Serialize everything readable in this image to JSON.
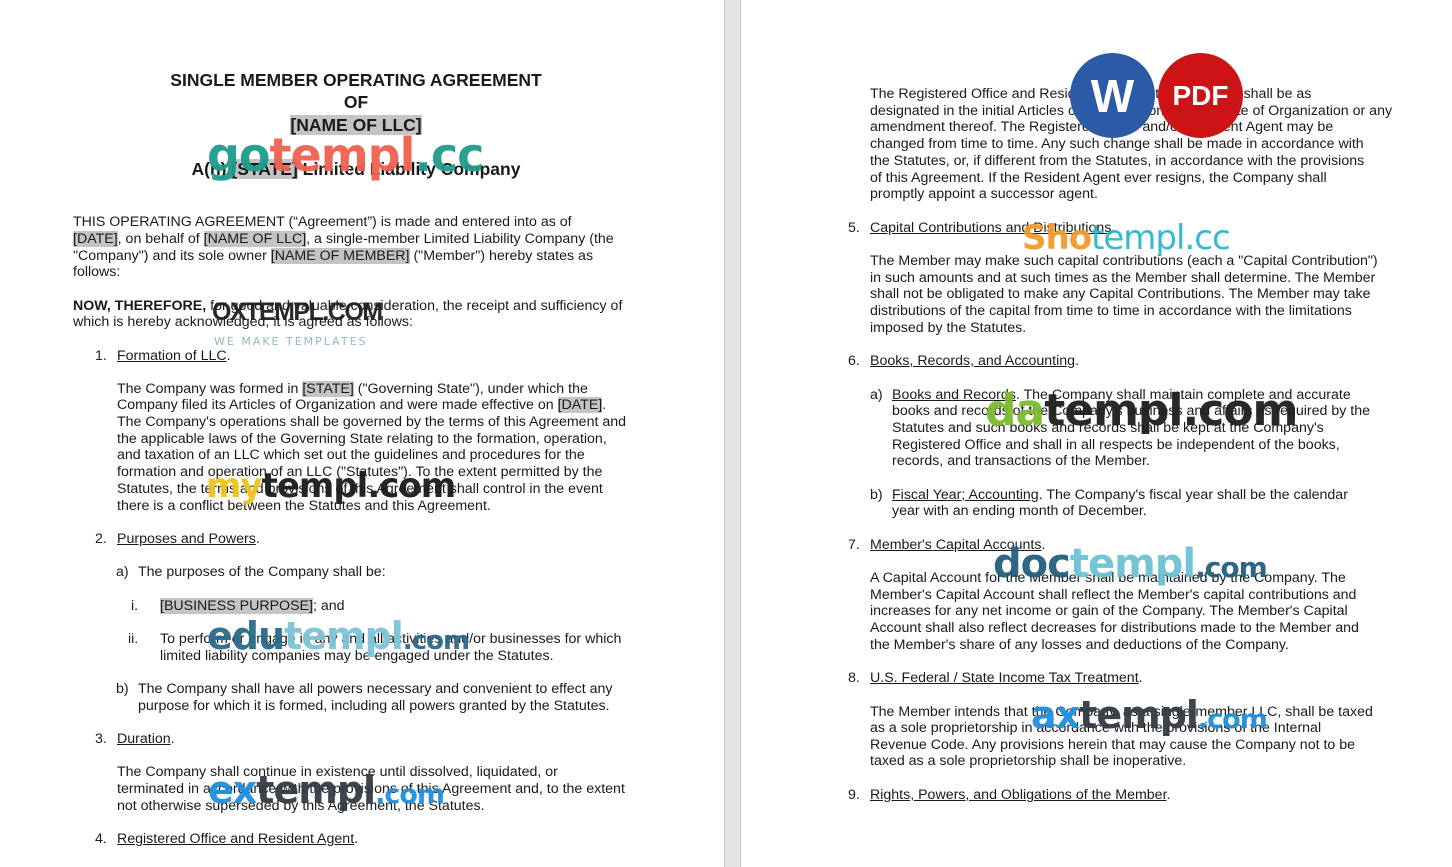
{
  "left_page": {
    "title_line1": "SINGLE MEMBER OPERATING AGREEMENT",
    "title_line2": "OF",
    "title_line3": "[NAME OF LLC]",
    "subtitle_prefix": "A(n) ",
    "subtitle_state": "[STATE]",
    "subtitle_suffix": " Limited Liability Company",
    "intro": {
      "l1": "THIS OPERATING AGREEMENT (“Agreement”) is made and entered into as of",
      "l2_date": "[DATE]",
      "l2_mid": ", on behalf of ",
      "l2_name": "[NAME OF LLC]",
      "l2_end": ", a single-member Limited Liability Company (the",
      "l3_start": "\"Company\") and its sole owner ",
      "l3_member": "[NAME OF MEMBER]",
      "l3_end": " (\"Member\") hereby states as",
      "l4": "follows:"
    },
    "now_therefore": {
      "bold": "NOW, THEREFORE,",
      "l1_rest": " for good and valuable consideration, the receipt and sufficiency of",
      "l2": "which is hereby acknowledged, it is agreed as follows:"
    },
    "s1": {
      "num": "1.",
      "heading": "Formation of LLC",
      "l1_start": "The Company was formed in ",
      "l1_state": "[STATE]",
      "l1_end": " (\"Governing State\"), under which the",
      "l2_start": "Company filed its Articles of Organization and were made effective on ",
      "l2_date": "[DATE]",
      "l2_end": ".",
      "l3": "The Company's operations shall be governed by the terms of this Agreement and",
      "l4": "the applicable laws of the Governing State relating to the formation, operation,",
      "l5": "and taxation of an LLC which set out the guidelines and procedures for the",
      "l6": "formation and operation of an LLC (\"Statutes\"). To the extent permitted by the",
      "l7": "Statutes, the terms and provisions of this Agreement shall control in the event",
      "l8": "there is a conflict between the Statutes and this Agreement."
    },
    "s2": {
      "num": "2.",
      "heading": "Purposes and Powers",
      "a_label": "a)",
      "a_text": "The purposes of the Company shall be:",
      "i_label": "i.",
      "i_hl": "[BUSINESS PURPOSE]",
      "i_end": "; and",
      "ii_label": "ii.",
      "ii_l1": "To perform or engage in any and all activities and/or businesses for which",
      "ii_l2": "limited liability companies may be engaged under the Statutes.",
      "b_label": "b)",
      "b_l1": "The Company shall have all powers necessary and convenient to effect any",
      "b_l2": "purpose for which it is formed, including all powers granted by the Statutes."
    },
    "s3": {
      "num": "3.",
      "heading": "Duration",
      "l1": "The Company shall continue in existence until dissolved, liquidated, or",
      "l2": "terminated in accordance with the provisions of this Agreement and, to the extent",
      "l3": "not otherwise superseded by this Agreement, the Statutes."
    },
    "s4": {
      "num": "4.",
      "heading": "Registered Office and Resident Agent"
    }
  },
  "right_page": {
    "s4_body": [
      "The Registered Office and Resident Agent of the Company shall be as",
      "designated in the initial Articles of Organization or Certificate of Organization or any",
      "amendment thereof. The Registered Office and/or Resident Agent may be",
      "changed from time to time. Any such change shall be made in accordance with",
      "the Statutes, or, if different from the Statutes, in accordance with the provisions",
      "of this Agreement. If the Resident Agent ever resigns, the Company shall",
      "promptly appoint a successor agent."
    ],
    "s5": {
      "num": "5.",
      "heading": "Capital Contributions and Distributions",
      "body": [
        "The Member may make such capital contributions (each a \"Capital Contribution\")",
        "in such amounts and at such times as the Member shall determine. The Member",
        "shall not be obligated to make any Capital Contributions. The Member may take",
        "distributions of the capital from time to time in accordance with the limitations",
        "imposed by the Statutes."
      ]
    },
    "s6": {
      "num": "6.",
      "heading": "Books, Records, and Accounting",
      "a_label": "a)",
      "a_heading": "Books and Records",
      "a_l1_rest": ". The Company shall maintain complete and accurate",
      "a_rest": [
        "books and records of the Company's business and affairs as required by the",
        "Statutes and such books and records shall be kept at the Company's",
        "Registered Office and shall in all respects be independent of the books,",
        "records, and transactions of the Member."
      ],
      "b_label": "b)",
      "b_heading": "Fiscal Year; Accounting",
      "b_l1_rest": ". The Company's fiscal year shall be the calendar",
      "b_l2": "year with an ending month of December."
    },
    "s7": {
      "num": "7.",
      "heading": "Member's Capital Accounts",
      "body": [
        "A Capital Account for the Member shall be maintained by the Company. The",
        "Member's Capital Account shall reflect the Member's capital contributions and",
        "increases for any net income or gain of the Company. The Member's Capital",
        "Account shall also reflect decreases for distributions made to the Member and",
        "the Member's share of any losses and deductions of the Company."
      ]
    },
    "s8": {
      "num": "8.",
      "heading": "U.S. Federal / State Income Tax Treatment",
      "body": [
        "The Member intends that the Company, as a single-member LLC, shall be taxed",
        "as a sole proprietorship in accordance with the provisions of the Internal",
        "Revenue Code. Any provisions herein that may cause the Company not to be",
        "taxed as a sole proprietorship shall be inoperative."
      ]
    },
    "s9": {
      "num": "9.",
      "heading": "Rights, Powers, and Obligations of the Member"
    }
  },
  "badges": {
    "word_label": "W",
    "pdf_label": "PDF",
    "word_color": "#2b5aa6",
    "pdf_color": "#cc1417"
  },
  "watermarks": {
    "gotempl": {
      "a": "go",
      "b": "templ",
      "c": ".cc"
    },
    "oxtempl": {
      "main": "OXTEMPL.COM",
      "tag": "WE MAKE TEMPLATES"
    },
    "mytempl": {
      "a": "my",
      "b": "templ.com"
    },
    "edutempl": {
      "a": "edu",
      "b": "templ",
      "c": ".com"
    },
    "extempl": {
      "a": "ex",
      "b": "templ",
      "c": ".com"
    },
    "shotempl": {
      "a": "Sho",
      "b": "templ.cc"
    },
    "datempl": {
      "a": "da",
      "b": "templ.com"
    },
    "doctempl": {
      "a": "doc",
      "b": "templ",
      "c": ".com"
    },
    "axtempl": {
      "a": "ax",
      "b": "templ",
      "c": ".com"
    }
  }
}
